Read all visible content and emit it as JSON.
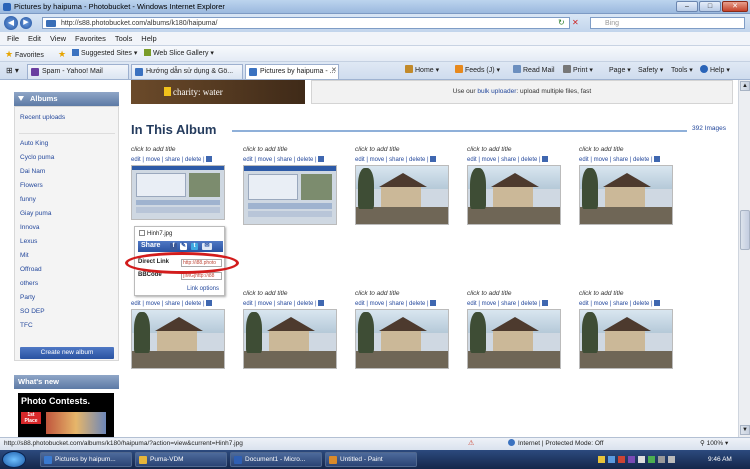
{
  "window": {
    "title": "Pictures by haipuma - Photobucket - Windows Internet Explorer",
    "min": "–",
    "max": "□",
    "close": "✕"
  },
  "address": {
    "url": "http://s88.photobucket.com/albums/k180/haipuma/",
    "search_placeholder": "Bing"
  },
  "menu": [
    "File",
    "Edit",
    "View",
    "Favorites",
    "Tools",
    "Help"
  ],
  "favorites": {
    "label": "Favorites",
    "suggested": "Suggested Sites ▾",
    "webslice": "Web Slice Gallery ▾"
  },
  "tabs": [
    {
      "label": "Spam - Yahoo! Mail"
    },
    {
      "label": "Hướng dẫn sử dụng & Gö..."
    },
    {
      "label": "Pictures by haipuma - ..."
    }
  ],
  "commands": {
    "home": "Home ▾",
    "feeds": "Feeds (J) ▾",
    "read_mail": "Read Mail",
    "print": "Print ▾",
    "page": "Page ▾",
    "safety": "Safety ▾",
    "tools": "Tools ▾",
    "help": "Help ▾"
  },
  "sidebar": {
    "albums_title": "Albums",
    "recent": "Recent uploads",
    "albums": [
      "Auto King",
      "Cyclo puma",
      "Dai Nam",
      "Flowers",
      "funny",
      "Giay puma",
      "Innova",
      "Lexus",
      "Mit",
      "Offroad",
      "others",
      "Party",
      "SO DEP",
      "TFC"
    ],
    "create_button": "Create new album",
    "whats_new": "What's new",
    "promo_title": "Photo Contests.",
    "promo_badge": "1st Place"
  },
  "banner": {
    "text": "charity: water"
  },
  "upload_bar": {
    "prefix": "Use our ",
    "link": "bulk uploader",
    "suffix": ": upload multiple files, fast"
  },
  "album": {
    "title": "In This Album",
    "count": "392 Images"
  },
  "grid": {
    "title_text": "click to add title",
    "actions": "edit | move | share | delete |",
    "rows": [
      [
        "shot",
        "shot",
        "house",
        "house",
        "house"
      ],
      [
        "house",
        "house",
        "house",
        "house",
        "house"
      ]
    ]
  },
  "popup": {
    "filename": "Hinh7.jpg",
    "share": "Share",
    "direct_link_label": "Direct Link",
    "direct_link_value": "http://i88.photo",
    "bbcode_label": "BBCode",
    "bbcode_value": "[IMG]http://i88",
    "link_options": "Link options"
  },
  "status": {
    "url": "http://s88.photobucket.com/albums/k180/haipuma/?action=view&current=Hinh7.jpg",
    "zone": "Internet | Protected Mode: Off",
    "zoom": "100%"
  },
  "taskbar": {
    "items": [
      "Pictures by haipum...",
      "Puma-VDM",
      "Document1 - Micro...",
      "Untitled - Paint"
    ],
    "time": "9:46 AM"
  },
  "colors": {
    "accent": "#2952a1",
    "link": "#24489c",
    "highlight": "#d21c1c"
  }
}
